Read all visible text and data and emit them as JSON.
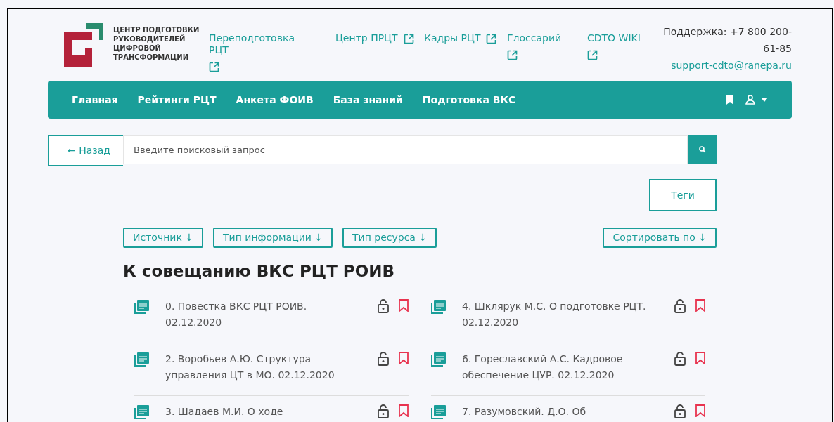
{
  "logo": {
    "lines": [
      "ЦЕНТР ПОДГОТОВКИ",
      "РУКОВОДИТЕЛЕЙ",
      "ЦИФРОВОЙ",
      "ТРАНСФОРМАЦИИ"
    ]
  },
  "top_links": [
    {
      "label": "Переподготовка РЦТ"
    },
    {
      "label": "Центр ПРЦТ"
    },
    {
      "label": "Кадры РЦТ"
    },
    {
      "label": "Глоссарий"
    },
    {
      "label": "CDTO WIKI"
    }
  ],
  "support": {
    "phone": "Поддержка: +7 800 200-61-85",
    "email": "support-cdto@ranepa.ru"
  },
  "navbar": {
    "items": [
      {
        "label": "Главная"
      },
      {
        "label": "Рейтинги РЦТ"
      },
      {
        "label": "Анкета ФОИВ"
      },
      {
        "label": "База знаний"
      },
      {
        "label": "Подготовка ВКС"
      }
    ]
  },
  "back_button": "← Назад",
  "search": {
    "placeholder": "Введите поисковый запрос"
  },
  "tags_button": "Теги",
  "filters": [
    {
      "label": "Источник ↓"
    },
    {
      "label": "Тип информации ↓"
    },
    {
      "label": "Тип ресурса ↓"
    }
  ],
  "sort_button": "Сортировать по ↓",
  "heading": "К совещанию ВКС РЦТ РОИВ",
  "documents": [
    {
      "title": "0. Повестка ВКС РЦТ РОИВ. 02.12.2020"
    },
    {
      "title": "4. Шклярук М.С. О подготовке РЦТ. 02.12.2020"
    },
    {
      "title": "2. Воробьев А.Ю. Структура управления ЦТ в МО. 02.12.2020"
    },
    {
      "title": "6. Гореславский А.С. Кадровое обеспечение ЦУР. 02.12.2020"
    },
    {
      "title": "3. Шадаев М.И. О ходе"
    },
    {
      "title": "7. Разумовский. Д.О. Об"
    }
  ]
}
